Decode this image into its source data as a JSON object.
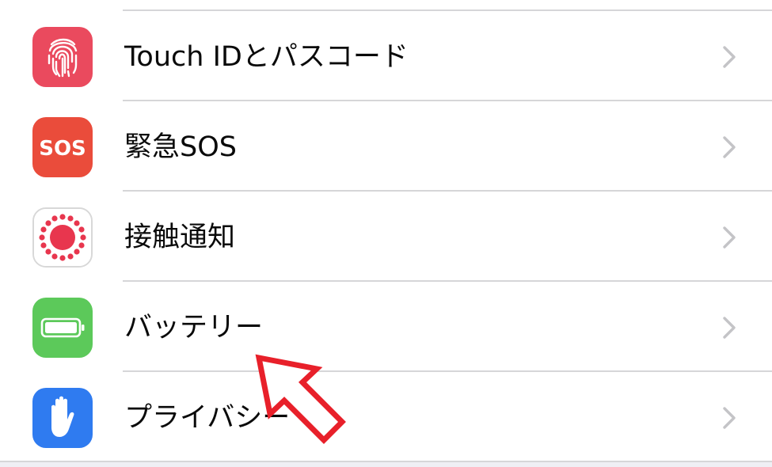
{
  "settings_list": {
    "items": [
      {
        "label": "Touch IDとパスコード",
        "icon": "fingerprint-icon",
        "icon_color": "#ea4a5e"
      },
      {
        "label": "緊急SOS",
        "icon": "sos-icon",
        "icon_text": "SOS",
        "icon_color": "#ea4c3b"
      },
      {
        "label": "接触通知",
        "icon": "exposure-notification-icon",
        "icon_color": "#ffffff"
      },
      {
        "label": "バッテリー",
        "icon": "battery-icon",
        "icon_color": "#5cc95a"
      },
      {
        "label": "プライバシー",
        "icon": "hand-icon",
        "icon_color": "#2f7bf0"
      }
    ]
  },
  "annotation": {
    "icon": "red-arrow-icon",
    "color": "#e8202a"
  }
}
